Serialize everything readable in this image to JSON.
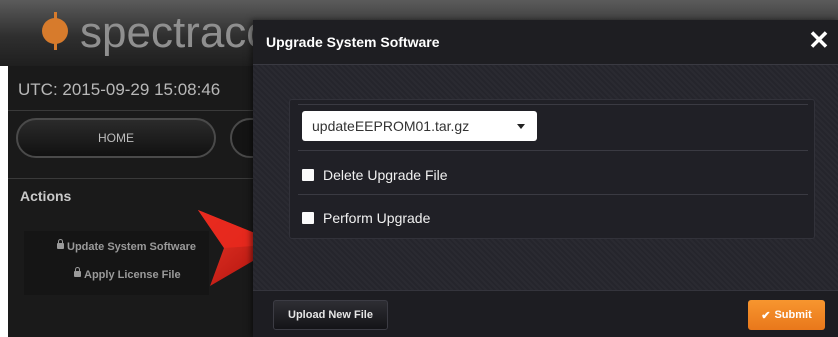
{
  "app": {
    "logo_text": "spectracom",
    "utc": "UTC: 2015-09-29 15:08:46",
    "nav": {
      "home_label": "HOME"
    },
    "actions": {
      "title": "Actions",
      "items": [
        {
          "label": "Update System Software",
          "icon": "lock-icon"
        },
        {
          "label": "Apply License File",
          "icon": "lock-icon"
        }
      ]
    },
    "pointer_color": "#d21d16"
  },
  "dialog": {
    "title": "Upgrade System Software",
    "close_glyph": "✕",
    "file_select": {
      "selected": "updateEEPROM01.tar.gz"
    },
    "checkboxes": [
      {
        "label": "Delete Upgrade File",
        "checked": false
      },
      {
        "label": "Perform Upgrade",
        "checked": false
      }
    ],
    "footer": {
      "upload_label": "Upload New File",
      "submit_label": "Submit",
      "submit_icon": "check-icon",
      "submit_color": "#f08a25"
    }
  }
}
